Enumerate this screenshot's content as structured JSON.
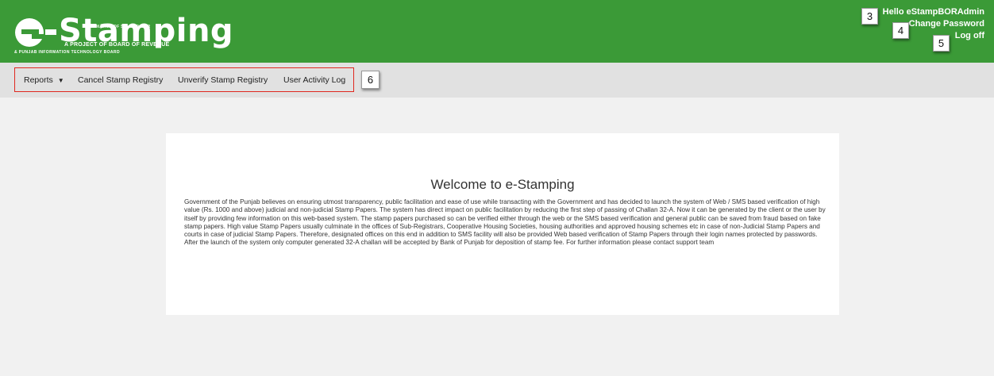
{
  "header": {
    "logo": {
      "tagline": "AUTOMATION OF STAMP PAPER",
      "word": "Stamping",
      "line1": "A PROJECT OF BOARD OF REVENUE",
      "line2": "& PUNJAB INFORMATION TECHNOLOGY BOARD"
    },
    "greeting": "Hello eStampBORAdmin",
    "change_password": "Change Password",
    "log_off": "Log off"
  },
  "callouts": {
    "c3": "3",
    "c4": "4",
    "c5": "5",
    "c6": "6"
  },
  "nav": {
    "reports": "Reports",
    "reports_caret": "▼",
    "cancel": "Cancel Stamp Registry",
    "unverify": "Unverify Stamp Registry",
    "activity": "User Activity Log"
  },
  "content": {
    "title": "Welcome to e-Stamping",
    "body": "Government of the Punjab believes on ensuring utmost transparency, public facilitation and ease of use while transacting with the Government and has decided to launch the system of Web / SMS based verification of high value (Rs. 1000 and above) judicial and non-judicial Stamp Papers. The system has direct impact on public facilitation by reducing the first step of passing of Challan 32-A. Now it can be generated by the client or the user by itself by providing few information on this web-based system. The stamp papers purchased so can be verified either through the web or the SMS based verification and general public can be saved from fraud based on fake stamp papers. High value Stamp Papers usually culminate in the offices of Sub-Registrars, Cooperative Housing Societies, housing authorities and approved housing schemes etc in case of non-Judicial Stamp Papers and courts in case of judicial Stamp Papers. Therefore, designated offices on this end in addition to SMS facility will also be provided Web based verification of Stamp Papers through their login names protected by passwords. After the launch of the system only computer generated 32-A challan will be accepted by Bank of Punjab for deposition of stamp fee. For further information please contact support team"
  },
  "colors": {
    "header_green": "#3b9a37",
    "nav_bg": "#e1e1e1",
    "highlight_red": "#e0281f"
  }
}
